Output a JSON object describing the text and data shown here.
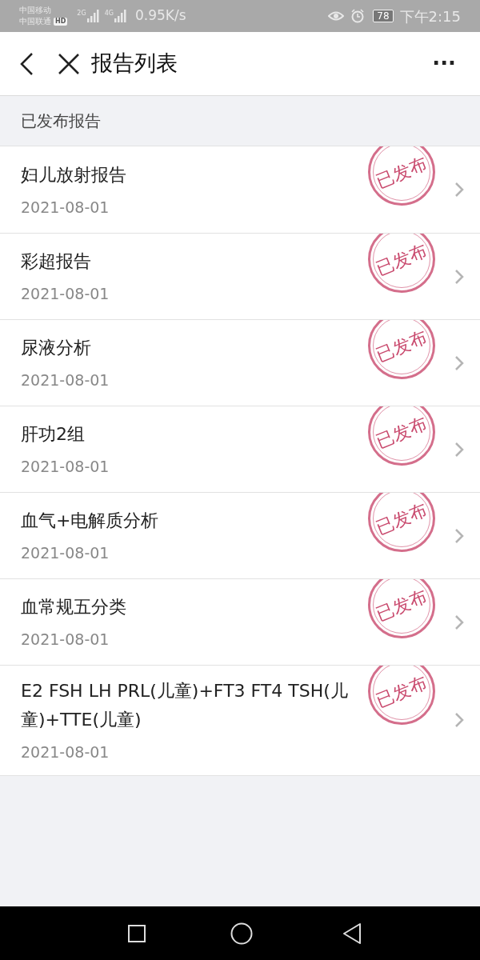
{
  "status_bar": {
    "carriers": [
      {
        "name": "中国移动",
        "hd": false
      },
      {
        "name": "中国联通",
        "hd": true
      }
    ],
    "hd_label": "HD",
    "networks": [
      "2G",
      "4G"
    ],
    "speed": "0.95K/s",
    "battery": "78",
    "time": "下午2:15"
  },
  "header": {
    "title": "报告列表",
    "more": "···"
  },
  "section": {
    "title": "已发布报告"
  },
  "reports": [
    {
      "name": "妇儿放射报告",
      "date": "2021-08-01",
      "stamp": "已发布"
    },
    {
      "name": "彩超报告",
      "date": "2021-08-01",
      "stamp": "已发布"
    },
    {
      "name": "尿液分析",
      "date": "2021-08-01",
      "stamp": "已发布"
    },
    {
      "name": "肝功2组",
      "date": "2021-08-01",
      "stamp": "已发布"
    },
    {
      "name": "血气+电解质分析",
      "date": "2021-08-01",
      "stamp": "已发布"
    },
    {
      "name": "血常规五分类",
      "date": "2021-08-01",
      "stamp": "已发布"
    },
    {
      "name": "E2 FSH LH PRL(儿童)+FT3 FT4 TSH(儿童)+TTE(儿童)",
      "date": "2021-08-01",
      "stamp": "已发布"
    }
  ]
}
